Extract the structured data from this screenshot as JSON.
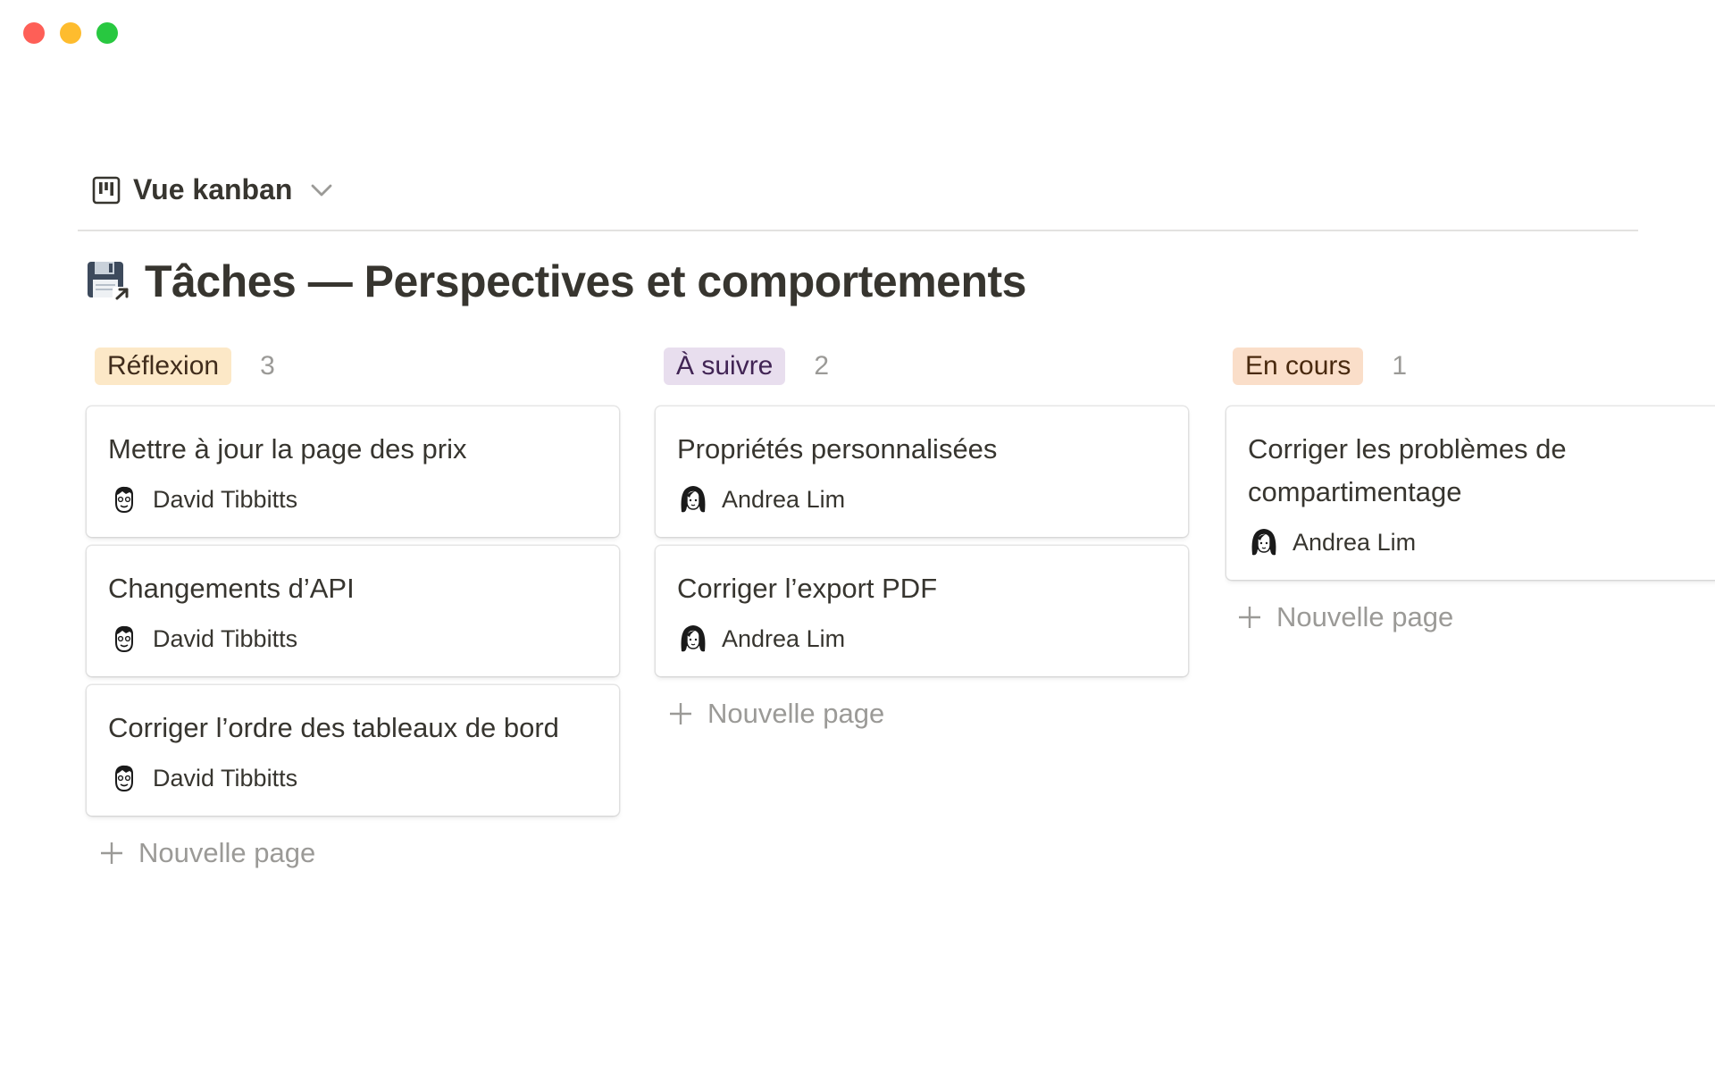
{
  "window": {
    "controls": [
      "close",
      "minimize",
      "maximize"
    ]
  },
  "view": {
    "label": "Vue kanban",
    "icon": "kanban-board-icon"
  },
  "page": {
    "emoji": "floppy-disk-link-icon",
    "title": "Tâches — Perspectives et comportements"
  },
  "columns": [
    {
      "tag": "Réflexion",
      "count": "3",
      "color": "#fce8c7",
      "cards": [
        {
          "title": "Mettre à jour la page des prix",
          "assignee": "David Tibbitts"
        },
        {
          "title": "Changements d’API",
          "assignee": "David Tibbitts"
        },
        {
          "title": "Corriger l’ordre des tableaux de bord",
          "assignee": "David Tibbitts"
        }
      ],
      "new_page": "Nouvelle page"
    },
    {
      "tag": "À suivre",
      "count": "2",
      "color": "#e8deee",
      "cards": [
        {
          "title": "Propriétés personnalisées",
          "assignee": "Andrea Lim"
        },
        {
          "title": "Corriger l’export PDF",
          "assignee": "Andrea Lim"
        }
      ],
      "new_page": "Nouvelle page"
    },
    {
      "tag": "En cours",
      "count": "1",
      "color": "#fadec9",
      "cards": [
        {
          "title": "Corriger les problèmes de compartimentage",
          "assignee": "Andrea Lim"
        }
      ],
      "new_page": "Nouvelle page"
    }
  ]
}
